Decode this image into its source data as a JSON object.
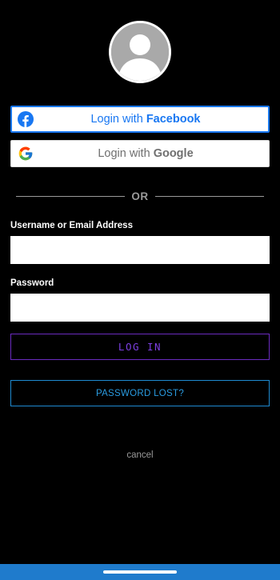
{
  "social": {
    "facebook": {
      "prefix": "Login with ",
      "brand": "Facebook",
      "icon": "facebook-icon",
      "color": "#1877f2"
    },
    "google": {
      "prefix": "Login with ",
      "brand": "Google",
      "icon": "google-icon",
      "color": "#6f6f6f"
    }
  },
  "divider": {
    "text": "OR"
  },
  "form": {
    "username_label": "Username or Email Address",
    "username_value": "",
    "password_label": "Password",
    "password_value": ""
  },
  "buttons": {
    "login_label": "LOG IN",
    "password_lost_label": "PASSWORD LOST?",
    "cancel_label": "cancel"
  },
  "colors": {
    "background": "#000000",
    "login_accent": "#7b3fe0",
    "lost_accent": "#2a9be0",
    "nav_bar": "#1f7bcc"
  }
}
